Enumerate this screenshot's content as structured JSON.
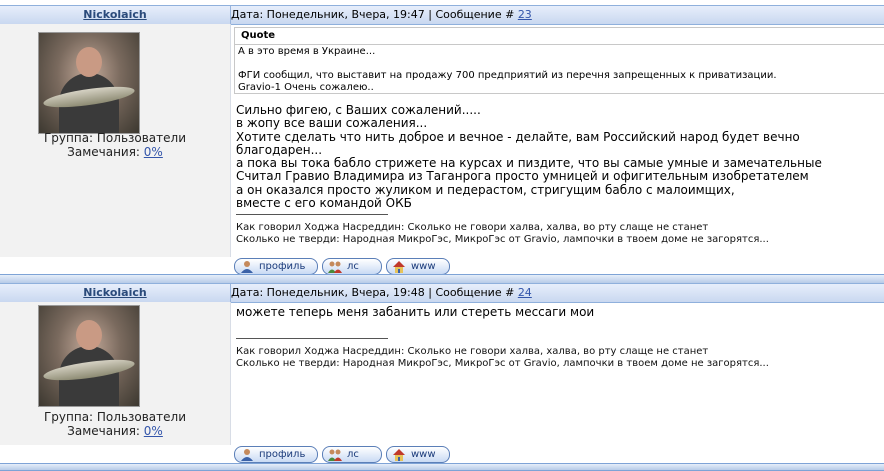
{
  "posts": [
    {
      "author": "Nickolaich",
      "date_text": "Дата: Понедельник, Вчера, 19:47 | Сообщение # ",
      "post_number": "23",
      "group": "Группа: Пользователи",
      "warnings_label": "Замечания: ",
      "warnings_value": "0%",
      "quote": {
        "title": "Quote",
        "lines": [
          "А в это время в Украине...",
          "",
          "ФГИ сообщил, что выставит на продажу 700 предприятий из перечня запрещенных к приватизации.",
          "Gravio-1 Очень сожалею.."
        ]
      },
      "message_lines": [
        "Сильно фигею, с Ваших сожалений.....",
        "в жопу все ваши сожаления...",
        "Хотите сделать что нить доброе и вечное - делайте, вам Российский народ будет вечно благодарен...",
        "а пока вы тока бабло стрижете на курсах и пиздите, что вы самые умные и замечательные",
        "Считал Гравио Владимира из Таганрога просто умницей и офигительным изобретателем",
        "а он оказался просто жуликом и педерастом, стригущим бабло с малоимщих,",
        "вместе с его командой ОКБ"
      ],
      "signature": [
        "Как говорил Ходжа Насреддин: Сколько не говори халва, халва, во рту слаще не станет",
        "Сколько не тверди: Народная МикроГэс, МикроГэс от Gravio, лампочки в твоем доме не загорятся..."
      ],
      "buttons": {
        "profile": "профиль",
        "pm": "лс",
        "www": "www"
      }
    },
    {
      "author": "Nickolaich",
      "date_text": "Дата: Понедельник, Вчера, 19:48 | Сообщение # ",
      "post_number": "24",
      "group": "Группа: Пользователи",
      "warnings_label": "Замечания: ",
      "warnings_value": "0%",
      "message_lines": [
        "можете теперь меня забанить или стереть мессаги мои"
      ],
      "signature": [
        "Как говорил Ходжа Насреддин: Сколько не говори халва, халва, во рту слаще не станет",
        "Сколько не тверди: Народная МикроГэс, МикроГэс от Gravio, лампочки в твоем доме не загорятся..."
      ],
      "buttons": {
        "profile": "профиль",
        "pm": "лс",
        "www": "www"
      }
    }
  ]
}
